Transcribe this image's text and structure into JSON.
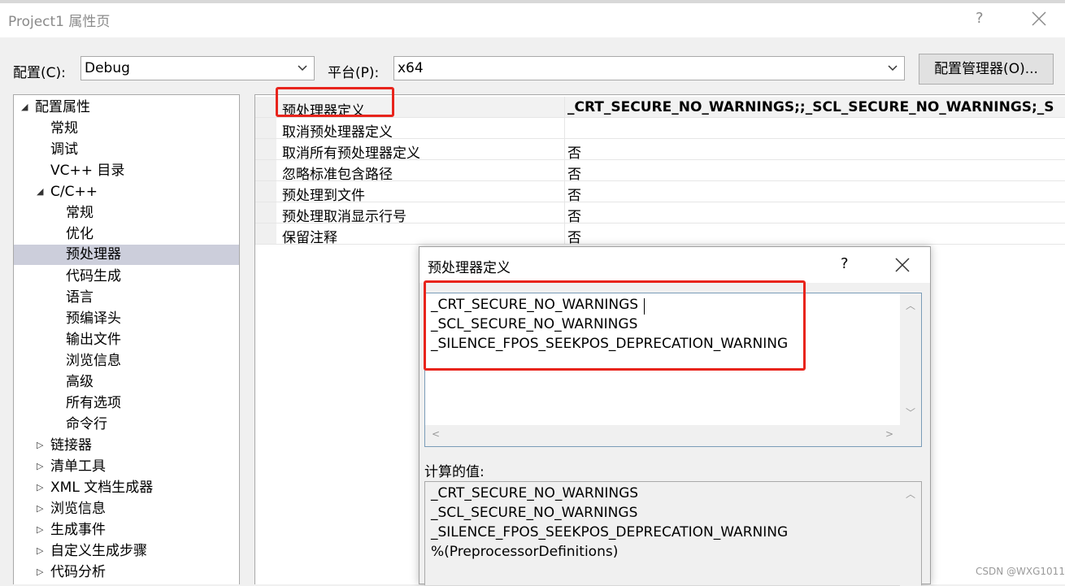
{
  "window": {
    "title": "Project1 属性页",
    "help": "?"
  },
  "toolbar": {
    "config_label": "配置(C):",
    "config_value": "Debug",
    "platform_label": "平台(P):",
    "platform_value": "x64",
    "config_manager_button": "配置管理器(O)..."
  },
  "tree": {
    "root": "配置属性",
    "general": "常规",
    "debugging": "调试",
    "vc_dirs": "VC++ 目录",
    "cpp": "C/C++",
    "cpp_children": [
      "常规",
      "优化",
      "预处理器",
      "代码生成",
      "语言",
      "预编译头",
      "输出文件",
      "浏览信息",
      "高级",
      "所有选项",
      "命令行"
    ],
    "selected": "预处理器",
    "collapsed": [
      "链接器",
      "清单工具",
      "XML 文档生成器",
      "浏览信息",
      "生成事件",
      "自定义生成步骤",
      "代码分析"
    ]
  },
  "properties": [
    {
      "name": "预处理器定义",
      "value": "_CRT_SECURE_NO_WARNINGS;;_SCL_SECURE_NO_WARNINGS;_SILENCE_FPOS_SEEKPOS_DEPRECATION_WARNING;%(PreprocessorDefinitions)"
    },
    {
      "name": "取消预处理器定义",
      "value": ""
    },
    {
      "name": "取消所有预处理器定义",
      "value": "否"
    },
    {
      "name": "忽略标准包含路径",
      "value": "否"
    },
    {
      "name": "预处理到文件",
      "value": "否"
    },
    {
      "name": "预处理取消显示行号",
      "value": "否"
    },
    {
      "name": "保留注释",
      "value": "否"
    }
  ],
  "dialog": {
    "title": "预处理器定义",
    "help": "?",
    "lines": [
      "_CRT_SECURE_NO_WARNINGS",
      "_SCL_SECURE_NO_WARNINGS",
      "_SILENCE_FPOS_SEEKPOS_DEPRECATION_WARNING"
    ],
    "evaluated_label": "计算的值:",
    "evaluated_lines": [
      "_CRT_SECURE_NO_WARNINGS",
      "_SCL_SECURE_NO_WARNINGS",
      "_SILENCE_FPOS_SEEKPOS_DEPRECATION_WARNING",
      "%(PreprocessorDefinitions)"
    ]
  },
  "icons": {
    "tree_expanded": "expanded-triangle-icon",
    "tree_collapsed": "collapsed-triangle-icon",
    "dropdown": "chevron-down-icon",
    "close": "close-icon"
  },
  "colors": {
    "highlight_box": "#e8241c",
    "tree_selection": "#cccedb",
    "edit_border": "#7a9cb8"
  },
  "watermark": "CSDN @WXG1011"
}
